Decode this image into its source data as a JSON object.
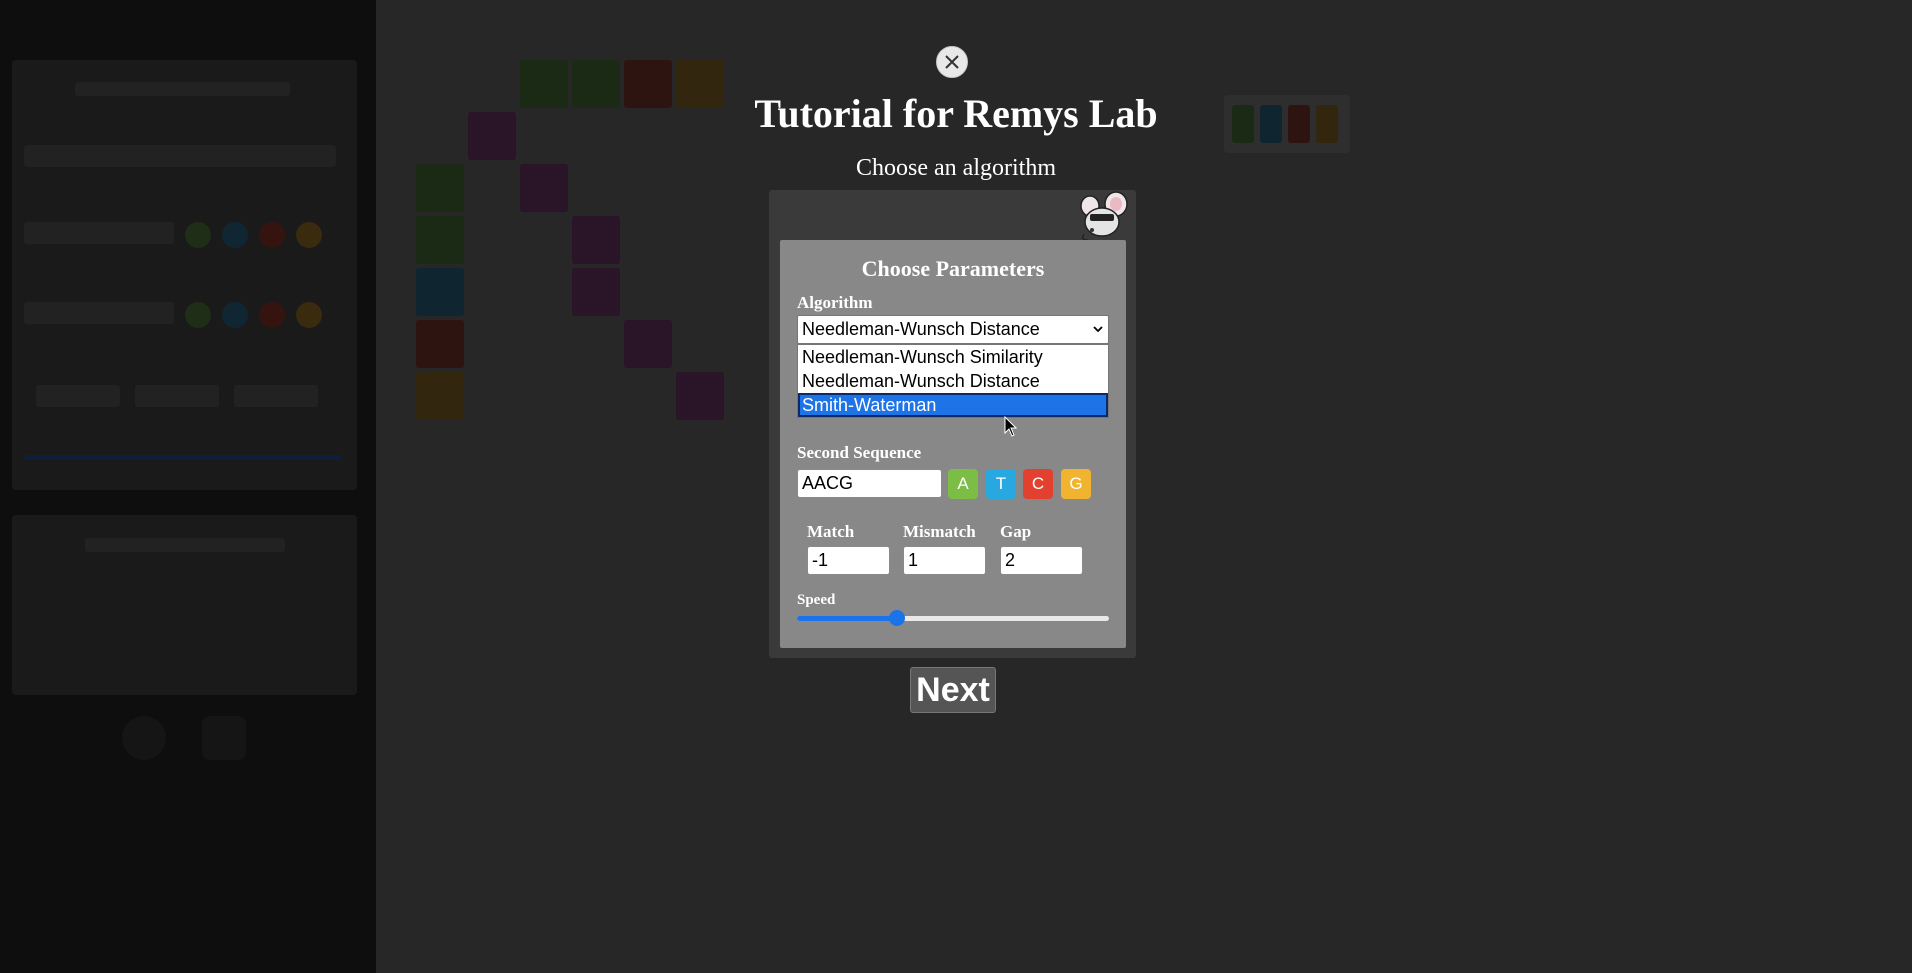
{
  "tutorial": {
    "title": "Tutorial for Remys Lab",
    "step_title": "Choose an algorithm",
    "next_label": "Next"
  },
  "params": {
    "heading": "Choose Parameters",
    "algorithm_label": "Algorithm",
    "algorithm_selected": "Needleman-Wunsch Distance",
    "algorithm_options": [
      "Needleman-Wunsch Similarity",
      "Needleman-Wunsch Distance",
      "Smith-Waterman"
    ],
    "highlighted_option": "Smith-Waterman",
    "second_sequence_label": "Second Sequence",
    "second_sequence_value": "AACG",
    "nucleotides": [
      "A",
      "T",
      "C",
      "G"
    ],
    "match_label": "Match",
    "match_value": "-1",
    "mismatch_label": "Mismatch",
    "mismatch_value": "1",
    "gap_label": "Gap",
    "gap_value": "2",
    "speed_label": "Speed",
    "speed_level": 0.32
  },
  "colors": {
    "A": "#7cbd45",
    "T": "#27a8e0",
    "C": "#e3412f",
    "G": "#f0b431",
    "accent": "#1a73e8"
  },
  "icons": {
    "close": "close-icon",
    "mascot": "mouse-mascot-icon",
    "dropdown": "chevron-down-icon"
  }
}
